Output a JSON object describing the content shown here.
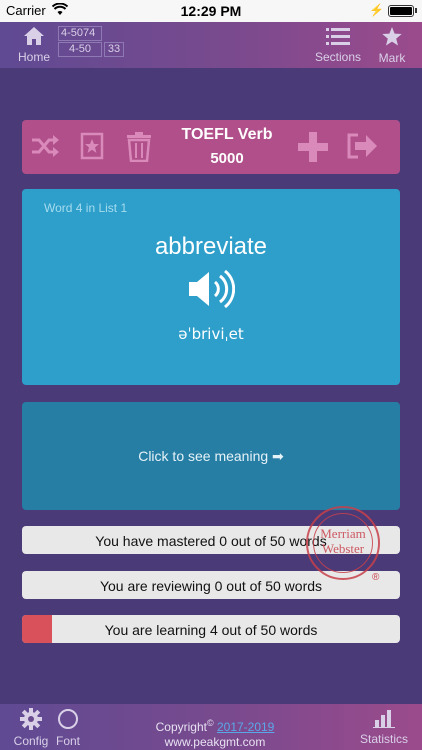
{
  "status_bar": {
    "carrier": "Carrier",
    "time": "12:29 PM"
  },
  "top_nav": {
    "home_label": "Home",
    "range_start": "4-5074",
    "range_sub": "4-50",
    "range_count": "33",
    "sections_label": "Sections",
    "mark_label": "Mark"
  },
  "toolbar": {
    "title": "TOEFL Verb",
    "count": "5000",
    "icons": [
      "shuffle-icon",
      "star-box-icon",
      "trash-icon",
      "plus-icon",
      "exit-icon"
    ]
  },
  "word_card": {
    "position_label": "Word 4 in List 1",
    "word": "abbreviate",
    "pronunciation": "əˈbriviˌet"
  },
  "meaning_card": {
    "prompt": "Click to see meaning ➡"
  },
  "progress": {
    "mastered_text": "You have mastered 0 out of 50 words",
    "mastered_fraction": 0,
    "reviewing_text": "You are reviewing 0 out of 50 words",
    "reviewing_fraction": 0,
    "learning_text": "You are learning 4 out of 50 words",
    "learning_fraction": 0.08
  },
  "stamp": {
    "line1": "Merriam",
    "line2": "Webster",
    "reg": "®"
  },
  "bottom_bar": {
    "config_label": "Config",
    "font_label": "Font",
    "copyright_prefix": "Copyright",
    "copyright_symbol": "©",
    "copyright_years": "2017-2019",
    "website": "www.peakgmt.com",
    "statistics_label": "Statistics"
  },
  "colors": {
    "background": "#4a3a78",
    "toolbar": "#b04f8a",
    "word_card": "#2d9fca",
    "meaning_card": "#277ea4",
    "learning_fill": "#d9515b"
  }
}
